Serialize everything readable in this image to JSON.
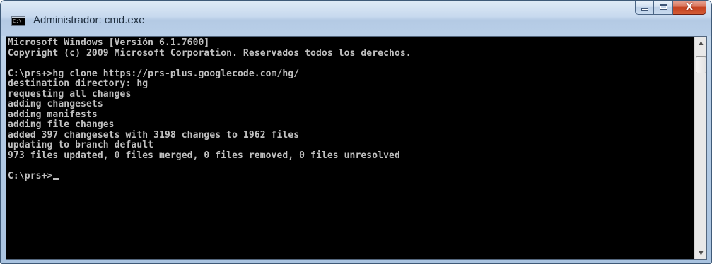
{
  "window": {
    "title": "Administrador: cmd.exe",
    "icon": "cmd-console-icon",
    "icon_text": "C:\\",
    "controls": [
      "minimize",
      "maximize",
      "close"
    ],
    "close_label": "X"
  },
  "console": {
    "lines": [
      "Microsoft Windows [Versión 6.1.7600]",
      "Copyright (c) 2009 Microsoft Corporation. Reservados todos los derechos.",
      "",
      "C:\\prs+>hg clone https://prs-plus.googlecode.com/hg/",
      "destination directory: hg",
      "requesting all changes",
      "adding changesets",
      "adding manifests",
      "adding file changes",
      "added 397 changesets with 3198 changes to 1962 files",
      "updating to branch default",
      "973 files updated, 0 files merged, 0 files removed, 0 files unresolved",
      "",
      "C:\\prs+>"
    ],
    "text_color": "#c0c0c0",
    "background_color": "#000000"
  },
  "scrollbar": {
    "up_arrow": "▲",
    "down_arrow": "▼"
  }
}
